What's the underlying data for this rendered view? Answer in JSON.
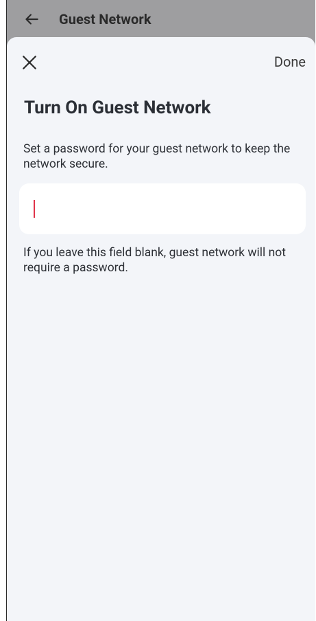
{
  "app_bar": {
    "title": "Guest Network",
    "back_icon": "arrow-left-icon"
  },
  "sheet": {
    "close_icon": "close-icon",
    "done_label": "Done",
    "title": "Turn On Guest Network",
    "description": "Set a password for your guest network to keep the network secure.",
    "password_field": {
      "value": "",
      "placeholder": ""
    },
    "hint": "If you leave this field blank, guest network will not require a password."
  },
  "colors": {
    "app_bar_bg": "#9e9ea0",
    "sheet_bg": "#f3f5f9",
    "input_bg": "#ffffff",
    "cursor": "#e0334a",
    "text": "#2e3137"
  }
}
